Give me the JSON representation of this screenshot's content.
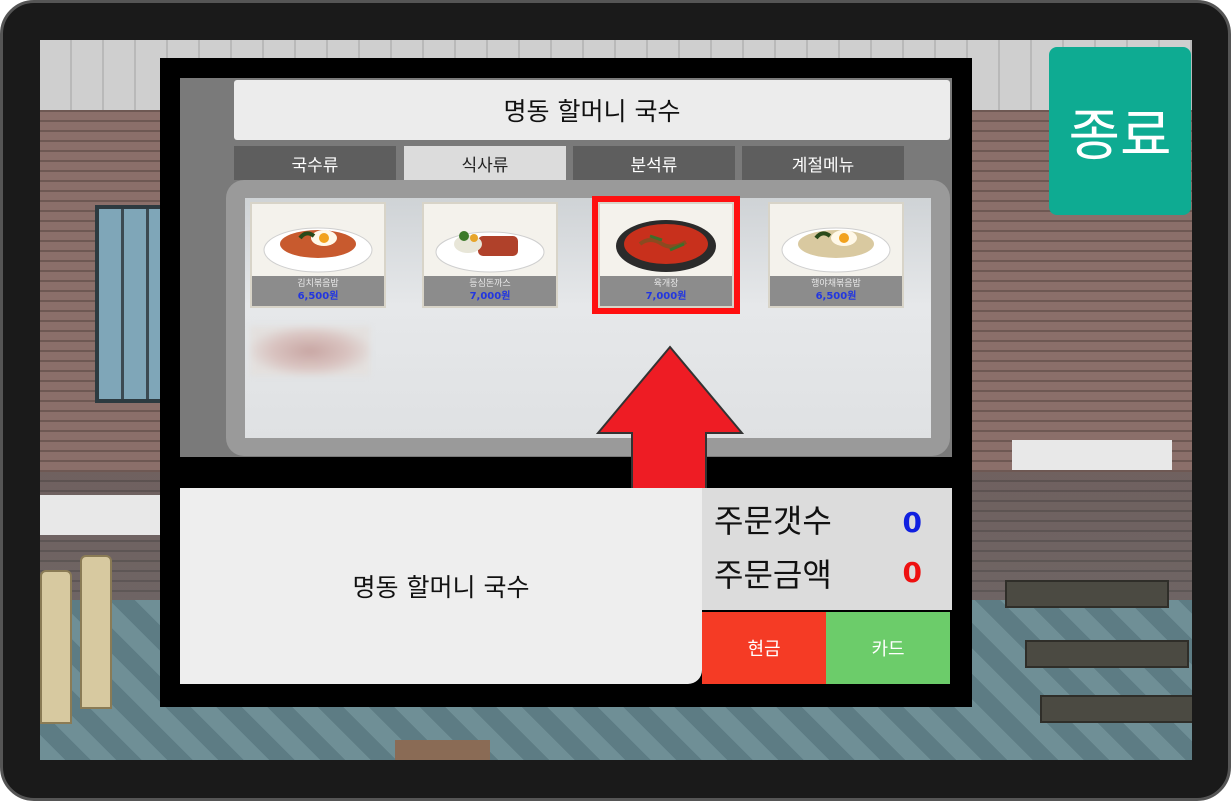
{
  "exit_button": {
    "label": "종료",
    "color": "#0eab92"
  },
  "header": {
    "title": "명동 할머니 국수"
  },
  "tabs": [
    {
      "label": "국수류",
      "active": false
    },
    {
      "label": "식사류",
      "active": true
    },
    {
      "label": "분석류",
      "active": false
    },
    {
      "label": "계절메뉴",
      "active": false
    }
  ],
  "menu_items": [
    {
      "name": "김치볶음밥",
      "price": "6,500원",
      "icon": "kimchi-fried-rice-icon",
      "selected": false
    },
    {
      "name": "등심돈까스",
      "price": "7,000원",
      "icon": "pork-cutlet-icon",
      "selected": false
    },
    {
      "name": "육개장",
      "price": "7,000원",
      "icon": "spicy-beef-soup-icon",
      "selected": true
    },
    {
      "name": "행야채볶음밥",
      "price": "6,500원",
      "icon": "vegetable-fried-rice-icon",
      "selected": false
    }
  ],
  "order": {
    "summary_text": "명동 할머니 국수",
    "count_label": "주문갯수",
    "count_value": "0",
    "amount_label": "주문금액",
    "amount_value": "0",
    "count_color": "#1020e0",
    "amount_color": "#ee1010"
  },
  "payment": {
    "cash_label": "현금",
    "card_label": "카드",
    "cash_color": "#f53b25",
    "card_color": "#6ccc6a"
  },
  "hint": {
    "icon": "up-arrow-icon",
    "color": "#ee1c24"
  }
}
